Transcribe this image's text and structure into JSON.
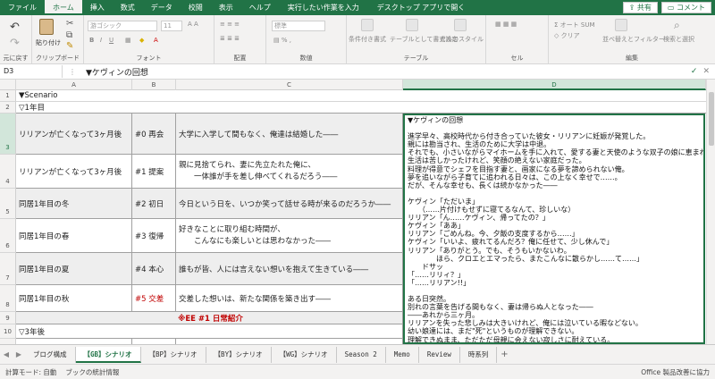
{
  "ribbon_tabs": [
    "ファイル",
    "ホーム",
    "挿入",
    "数式",
    "データ",
    "校閲",
    "表示",
    "ヘルプ"
  ],
  "active_tab": "ホーム",
  "tell_me": "実行したい作業を入力",
  "desktop_app": "デスクトップ アプリで開く",
  "share_label": "共有",
  "comment_label": "コメント",
  "ribbon_groups": {
    "undo": "元に戻す",
    "clipboard": "クリップボード",
    "paste": "貼り付け",
    "font": "フォント",
    "font_name": "游ゴシック",
    "font_size": "11",
    "alignment": "配置",
    "number": "数値",
    "number_format": "標準",
    "tables": "テーブル",
    "conditional": "条件付き書式",
    "format_table": "テーブルとして書式設定",
    "cell_styles": "セルのスタイル",
    "cells": "セル",
    "editing": "編集",
    "sort": "並べ替えとフィルター",
    "find": "検索と選択",
    "autosum": "オート SUM",
    "clear": "クリア"
  },
  "name_box": "D3",
  "formula_bar_text": "▼ケヴィンの回想",
  "columns": [
    "A",
    "B",
    "C",
    "D"
  ],
  "active_column": "D",
  "rows": {
    "r1": {
      "num": "1",
      "a": "▼Scenario"
    },
    "r2": {
      "num": "2",
      "a": "▽1年目"
    },
    "r3": {
      "num": "3",
      "a": "リリアンが亡くなって3ヶ月後",
      "b": "#0 再会",
      "c": "大学に入学して間もなく、俺達は結婚した――"
    },
    "r4": {
      "num": "4",
      "a": "リリアンが亡くなって3ヶ月後",
      "b": "#1 提案",
      "c": "親に見捨てられ、妻に先立たれた俺に、\n　　一体誰が手を差し伸べてくれるだろう――"
    },
    "r5": {
      "num": "5",
      "a": "同居1年目の冬",
      "b": "#2 初日",
      "c": "今日という日を、いつか笑って話せる時が来るのだろうか――"
    },
    "r6": {
      "num": "6",
      "a": "同居1年目の春",
      "b": "#3 復帰",
      "c": "好きなことに取り組む時間が、\n　　こんなにも楽しいとは思わなかった――"
    },
    "r7": {
      "num": "7",
      "a": "同居1年目の夏",
      "b": "#4 本心",
      "c": "誰もが皆、人には言えない想いを抱えて生きている――"
    },
    "r8": {
      "num": "8",
      "a": "同居1年目の秋",
      "b": "#5 交差",
      "c": "交差した想いは、新たな関係を築き出す――"
    },
    "r9": {
      "num": "9",
      "b": "※EE #1 日常紹介"
    },
    "r10": {
      "num": "10",
      "a": "▽3年後"
    }
  },
  "d3_text": "▼ケヴィンの回想\n\n進学早々、高校時代から付き合っていた彼女・リリアンに妊娠が発覚した。\n親には勘当され、生活のために大学は中退。\nそれでも、小さいながらマイホームを手に入れて、愛する妻と天使のような双子の娘に恵まれた。\n生活は苦しかったけれど、笑顔の絶えない家庭だった。\n料理が得意でシェフを目指す妻と、画家になる夢を諦められない俺。\n夢を追いながら子育てに追われる日々は、この上なく幸せで……。\nだが、そんな幸せも、長くは続かなかった――\n\nケヴィン「ただいま」\n　　（……片付けもせずに寝てるなんて、珍しいな）\nリリアン「ん……ケヴィン、帰ってたの？」\nケヴィン「ああ」\nリリアン「ごめんね。今、夕飯の支度するから……」\nケヴィン「いいよ、疲れてるんだろ？俺に任せて、少し休んで」\nリリアン「ありがとう。でも、そうもいかないわ。\n　　　　ほら、クロエとエマったら、またこんなに散らかし……て……」\n　　ドサッ\n「……リリィ？」\n「……リリアン!!」\n\nある日突然。\n別れの言葉を告げる間もなく、妻は帰らぬ人となった――\n――あれから三ヶ月。\nリリアンを失った悲しみは大きいけれど、俺には泣いている暇などない。\n幼い娘達には、まだ\"死\"というものが理解できない。\n理解できぬまま、ただただ母親に会えない寂しさに耐えている。\nクロエとエマのため、そして自分自身のためにも、",
  "sheet_tabs": [
    "ブログ構成",
    "【GB】シナリオ",
    "【BP】シナリオ",
    "【BY】シナリオ",
    "【WG】シナリオ",
    "Season 2",
    "Memo",
    "Review",
    "時系列"
  ],
  "active_sheet": "【GB】シナリオ",
  "status": {
    "calc_mode": "計算モード: 自動",
    "workbook_stats": "ブックの統計情報",
    "feedback": "Office 製品改善に協力"
  }
}
